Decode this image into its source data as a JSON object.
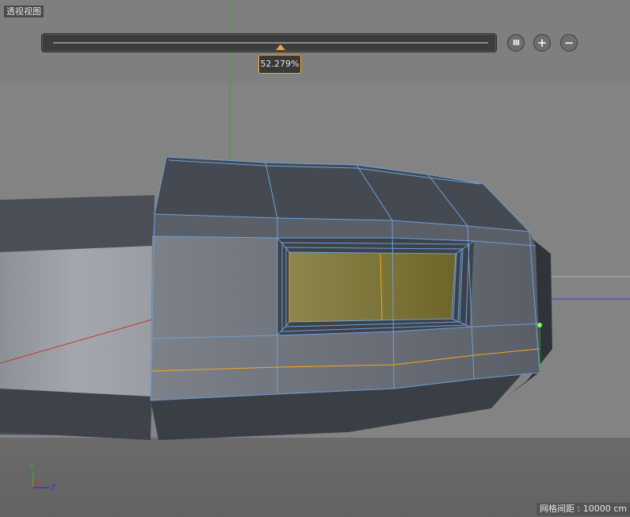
{
  "viewport": {
    "label": "透视视图",
    "grid_spacing": "网格间距 : 10000 cm"
  },
  "slider": {
    "value": "52.279%",
    "fraction": 0.52279,
    "pause_icon": "pause-icon",
    "plus_icon": "plus-icon",
    "minus_icon": "minus-icon",
    "pause_glyph": "III",
    "plus_glyph": "+",
    "minus_glyph": "−"
  },
  "axes": {
    "y_label": "Y",
    "x_label": "X",
    "z_label": "Z"
  },
  "colors": {
    "wire": "#6f9fd8",
    "loop": "#f6a623",
    "selected_face": "#8a8040",
    "y_axis": "#2fae2f",
    "x_axis": "#c0392b",
    "z_axis": "#2e3fbf",
    "point": "#7cfc5a"
  }
}
